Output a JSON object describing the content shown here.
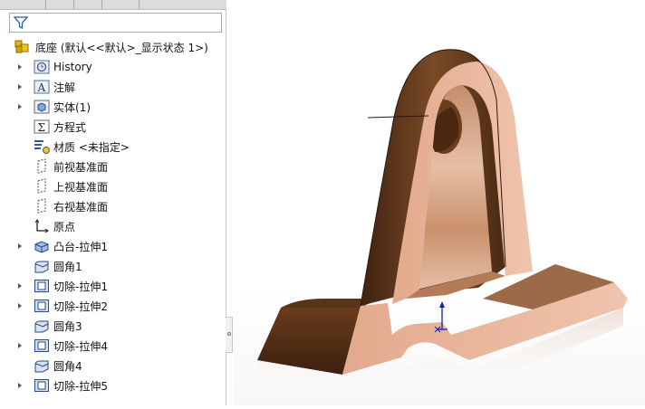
{
  "feature_tree": {
    "root": {
      "label": "底座 (默认<<默认>_显示状态 1>)",
      "icon": "part-icon"
    },
    "items": [
      {
        "label": "History",
        "icon": "history-icon",
        "expandable": true
      },
      {
        "label": "注解",
        "icon": "annotations-icon",
        "expandable": true
      },
      {
        "label": "实体(1)",
        "icon": "solid-bodies-icon",
        "expandable": true
      },
      {
        "label": "方程式",
        "icon": "equations-icon",
        "expandable": false
      },
      {
        "label": "材质 <未指定>",
        "icon": "material-icon",
        "expandable": false
      },
      {
        "label": "前视基准面",
        "icon": "plane-icon",
        "expandable": false
      },
      {
        "label": "上视基准面",
        "icon": "plane-icon",
        "expandable": false
      },
      {
        "label": "右视基准面",
        "icon": "plane-icon",
        "expandable": false
      },
      {
        "label": "原点",
        "icon": "origin-icon",
        "expandable": false
      },
      {
        "label": "凸台-拉伸1",
        "icon": "extrude-boss-icon",
        "expandable": true
      },
      {
        "label": "圆角1",
        "icon": "fillet-icon",
        "expandable": false
      },
      {
        "label": "切除-拉伸1",
        "icon": "extrude-cut-icon",
        "expandable": true
      },
      {
        "label": "切除-拉伸2",
        "icon": "extrude-cut-icon",
        "expandable": true
      },
      {
        "label": "圆角3",
        "icon": "fillet-icon",
        "expandable": false
      },
      {
        "label": "切除-拉伸4",
        "icon": "extrude-cut-icon",
        "expandable": true
      },
      {
        "label": "圆角4",
        "icon": "fillet-icon",
        "expandable": false
      },
      {
        "label": "切除-拉伸5",
        "icon": "extrude-cut-icon",
        "expandable": true
      }
    ]
  },
  "colors": {
    "wood_dark": "#5a3418",
    "wood_mid": "#7a4a26",
    "wood_light": "#e7b89c",
    "triad_blue": "#1020c0"
  }
}
